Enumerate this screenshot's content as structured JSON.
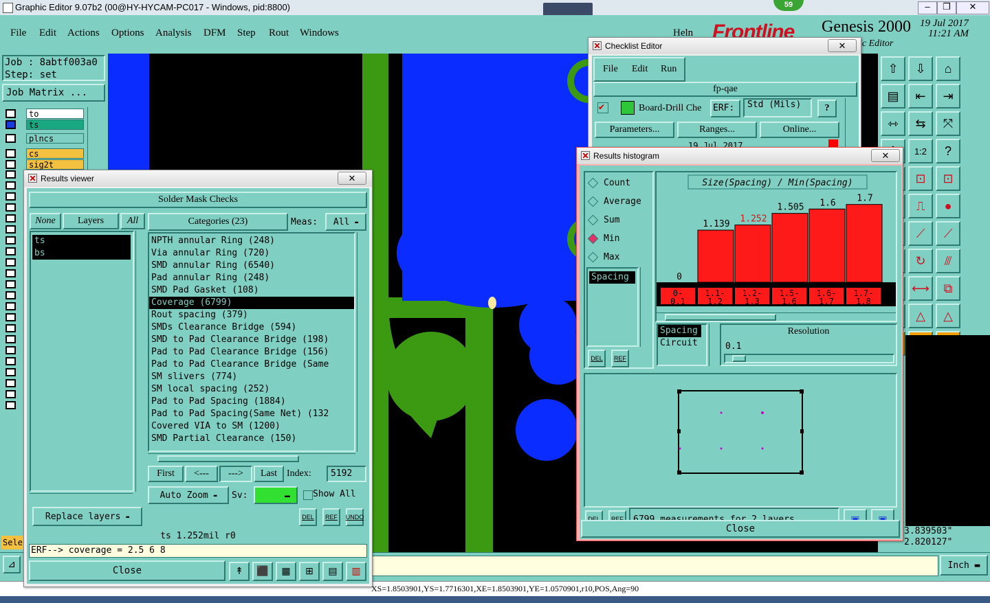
{
  "app": {
    "title": "Graphic Editor 9.07b2 (00@HY-HYCAM-PC017 - Windows, pid:8800)",
    "badge": "59",
    "brand": "Frontline",
    "product": "Genesis 2000",
    "date": "19 Jul 2017",
    "time": "11:21 AM",
    "subbrand": "ic Editor"
  },
  "menu": [
    "File",
    "Edit",
    "Actions",
    "Options",
    "Analysis",
    "DFM",
    "Step",
    "Rout",
    "Windows"
  ],
  "menu_help": "Heln",
  "left": {
    "job": "Job : 8abtf003a0",
    "step": "Step: set",
    "job_matrix": "Job Matrix ...",
    "layers": [
      {
        "name": "to",
        "color": "#ffffff"
      },
      {
        "name": "ts",
        "color": "#1aa882"
      },
      {
        "name": "plncs",
        "color": "#7fcfc2"
      },
      {
        "name": "cs",
        "color": "#f4c040"
      },
      {
        "name": "sig2t",
        "color": "#f4c040"
      }
    ],
    "sele": "Sele"
  },
  "results_viewer": {
    "title": "Results viewer",
    "header": "Solder Mask Checks",
    "none": "None",
    "layers": "Layers",
    "all": "All",
    "layer_items": [
      "ts",
      "bs"
    ],
    "categories": "Categories (23)",
    "meas_label": "Meas:",
    "meas_value": "All",
    "category_items": [
      "NPTH annular Ring (248)",
      "Via annular Ring (720)",
      "SMD annular Ring (6540)",
      "Pad annular Ring (248)",
      "SMD Pad Gasket (108)",
      "Coverage (6799)",
      "Rout spacing (379)",
      "SMDs Clearance Bridge (594)",
      "SMD to Pad Clearance Bridge (198)",
      "Pad to Pad Clearance Bridge (156)",
      "Pad to Pad Clearance Bridge (Same",
      "SM slivers (774)",
      "SM local spacing (252)",
      "Pad to Pad Spacing (1884)",
      "Pad to Pad Spacing(Same Net) (132",
      "Covered VIA to SM (1200)",
      "SMD Partial Clearance (150)"
    ],
    "selected_index": 5,
    "first": "First",
    "prev": "<---",
    "next": "--->",
    "last": "Last",
    "index_label": "Index:",
    "index_value": "5192",
    "auto_zoom": "Auto Zoom",
    "sv_label": "Sv:",
    "show_all": "Show All",
    "replace_layers": "Replace layers",
    "del": "DEL",
    "ref": "REF",
    "undo": "UNDO",
    "status": "ts 1.252mil  r0",
    "erf": "ERF--> coverage = 2.5 6 8",
    "close": "Close"
  },
  "checklist": {
    "title": "Checklist Editor",
    "menu": [
      "File",
      "Edit",
      "Run"
    ],
    "name": "fp-qae",
    "row_label": "Board-Drill Che",
    "erf_label": "ERF:",
    "erf_value": "Std (Mils)",
    "help": "?",
    "parameters": "Parameters...",
    "ranges": "Ranges...",
    "online": "Online...",
    "date": "19 Jul 2017"
  },
  "histogram": {
    "title": "Results histogram",
    "options": [
      "Count",
      "Average",
      "Sum",
      "Min",
      "Max"
    ],
    "selected_option": "Min",
    "list_items": [
      "Spacing"
    ],
    "chart_title": "Size(Spacing) / Min(Spacing)",
    "bars": [
      {
        "range": "0-0.1",
        "value": 0,
        "label": "0"
      },
      {
        "range": "1.1-1.2",
        "value": 1.139,
        "label": "1.139"
      },
      {
        "range": "1.2-1.3",
        "value": 1.252,
        "label": "1.252",
        "highlight": true
      },
      {
        "range": "1.5-1.6",
        "value": 1.505,
        "label": "1.505"
      },
      {
        "range": "1.6-1.7",
        "value": 1.6,
        "label": "1.6"
      },
      {
        "range": "1.7-1.8",
        "value": 1.7,
        "label": "1.7"
      }
    ],
    "range_labels": [
      "0-\n0.1",
      "1.1-\n1.2",
      "1.2-\n1.3",
      "1.5-\n1.6",
      "1.6-\n1.7",
      "1.7-\n1.8"
    ],
    "type_items": [
      "Spacing",
      "Circuit"
    ],
    "resolution_label": "Resolution",
    "resolution_value": "0.1",
    "del": "DEL",
    "ref": "REF",
    "measurements": "6799 measurements for 2 layers",
    "close": "Close",
    "bar_color": "#ff1a1a",
    "highlight_text_color": "#e01010"
  },
  "bottom": {
    "coords_x": "3.839503\"",
    "coords_y": "2.820127\"",
    "units": "Inch",
    "status_line": "XS=1.8503901,YS=1.7716301,XE=1.8503901,YE=1.0570901,r10,POS,Ang=90"
  },
  "colors": {
    "teal": "#7fcfc2",
    "copper_blue": "#0a2cff",
    "green": "#3c9a12"
  }
}
